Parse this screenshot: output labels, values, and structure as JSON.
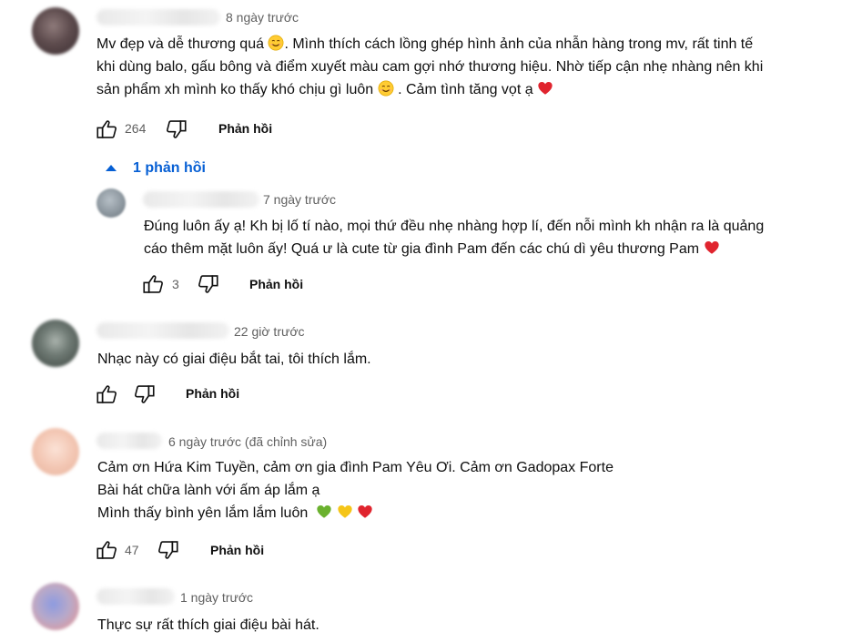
{
  "comments": [
    {
      "time": "8 ngày trước",
      "lines": [
        "Mv đẹp và dễ thương quá",
        ". Mình thích cách lồng ghép hình ảnh của nhẫn hàng trong mv, rất tinh tế",
        "khi dùng balo, gấu bông và điểm xuyết màu cam gợi nhớ thương hiệu. Nhờ tiếp cận nhẹ nhàng nên khi",
        "sản phẩm xh mình ko thấy khó chịu gì luôn",
        ". Cảm tình tăng vọt ạ"
      ],
      "likes": "264",
      "reply_label": "Phản hồi",
      "replies_toggle": "1 phản hồi"
    },
    {
      "time": "7 ngày trước",
      "lines": [
        "Đúng luôn ấy ạ! Kh bị lố tí nào, mọi thứ đều nhẹ nhàng hợp lí, đến nỗi mình kh nhận ra là quảng",
        "cáo thêm mặt luôn ấy! Quá ư là cute từ gia đình Pam đến các chú dì yêu thương Pam"
      ],
      "likes": "3",
      "reply_label": "Phản hồi"
    },
    {
      "time": "22 giờ trước",
      "lines": [
        "Nhạc này có giai điệu bắt tai, tôi thích lắm."
      ],
      "likes": "",
      "reply_label": "Phản hồi"
    },
    {
      "time": "6 ngày trước (đã chỉnh sửa)",
      "lines": [
        "Cảm ơn Hứa Kim Tuyền, cảm ơn gia đình Pam Yêu Ơi. Cảm ơn Gadopax Forte",
        "Bài hát chữa lành với ấm áp lắm ạ",
        "Mình thấy bình yên lắm lắm luôn"
      ],
      "likes": "47",
      "reply_label": "Phản hồi"
    },
    {
      "time": "1 ngày trước",
      "lines": [
        "Thực sự rất thích giai điệu bài hát."
      ]
    }
  ],
  "icons": {
    "like": "thumbs-up-outline",
    "dislike": "thumbs-down-outline",
    "caret": "caret-up",
    "emoji_smile": "smiling-face",
    "emoji_heart_red": "red-heart",
    "emoji_heart_green": "green-heart",
    "emoji_heart_yellow": "yellow-heart"
  },
  "colors": {
    "link_blue": "#065fd4",
    "meta_gray": "#606060",
    "text": "#0f0f0f",
    "heart_red": "#e0242e",
    "heart_green": "#6ab12e",
    "heart_yellow": "#f5c518"
  }
}
